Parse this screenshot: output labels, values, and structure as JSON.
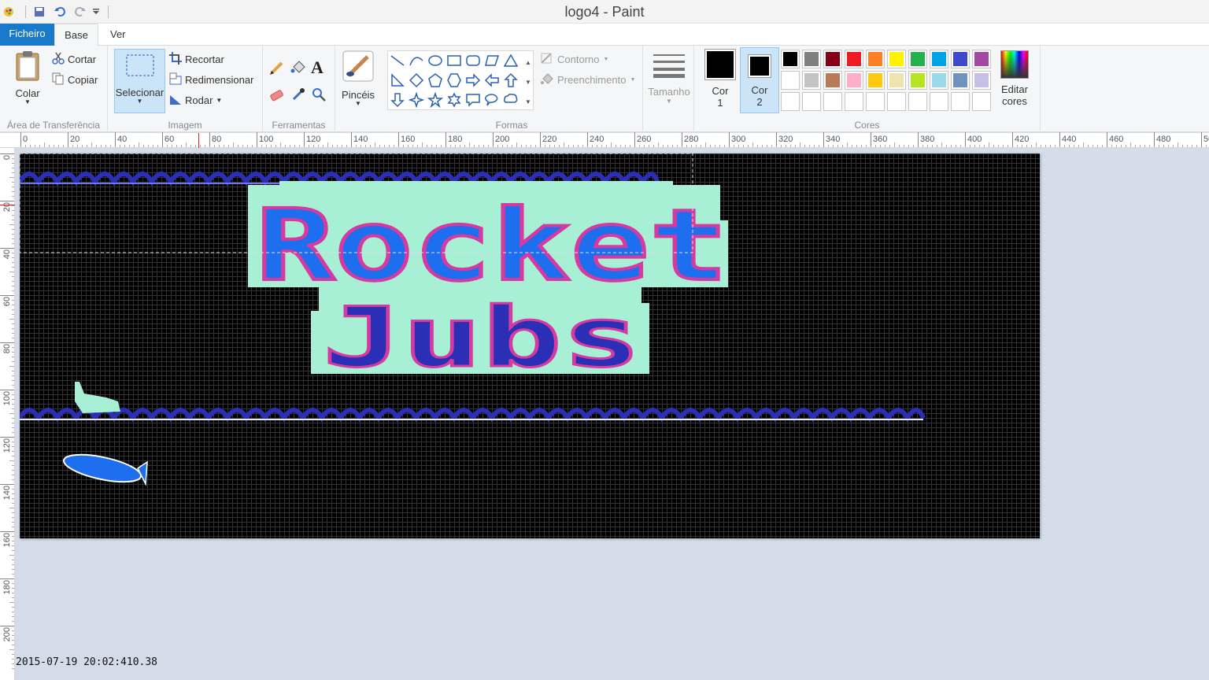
{
  "window": {
    "title": "logo4 - Paint"
  },
  "tabs": {
    "file": "Ficheiro",
    "base": "Base",
    "view": "Ver"
  },
  "clipboard": {
    "paste": "Colar",
    "cut": "Cortar",
    "copy": "Copiar",
    "group": "Área de Transferência"
  },
  "image": {
    "select": "Selecionar",
    "crop": "Recortar",
    "resize": "Redimensionar",
    "rotate": "Rodar",
    "group": "Imagem"
  },
  "tools": {
    "group": "Ferramentas"
  },
  "brushes": {
    "label": "Pincéis"
  },
  "shapes": {
    "outline": "Contorno",
    "fill": "Preenchimento",
    "group": "Formas"
  },
  "size": {
    "label": "Tamanho"
  },
  "colors": {
    "color1_line1": "Cor",
    "color1_line2": "1",
    "color2_line1": "Cor",
    "color2_line2": "2",
    "edit_line1": "Editar",
    "edit_line2": "cores",
    "group": "Cores",
    "color1": "#000000",
    "color2": "#000000",
    "palette_row1": [
      "#000000",
      "#7f7f7f",
      "#880015",
      "#ed1c24",
      "#ff7f27",
      "#fff200",
      "#22b14c",
      "#00a2e8",
      "#3f48cc",
      "#a349a4"
    ],
    "palette_row2": [
      "#ffffff",
      "#c3c3c3",
      "#b97a57",
      "#ffaec9",
      "#ffc90e",
      "#efe4b0",
      "#b5e61d",
      "#99d9ea",
      "#7092be",
      "#c8bfe7"
    ]
  },
  "ruler": {
    "h": [
      "0",
      "20",
      "40",
      "60",
      "80",
      "100",
      "120",
      "140",
      "160",
      "180",
      "200",
      "220",
      "240",
      "260",
      "280",
      "300",
      "320",
      "340",
      "360",
      "380",
      "400",
      "420",
      "440",
      "460",
      "480",
      "50"
    ],
    "v": [
      "0",
      "20",
      "40",
      "60",
      "80",
      "100",
      "120",
      "140",
      "160",
      "180",
      "200"
    ]
  },
  "canvas": {
    "logo_line1": "Rocket",
    "logo_line2": "Jubs"
  },
  "status": {
    "timestamp": "2015-07-19 20:02:410.38"
  }
}
